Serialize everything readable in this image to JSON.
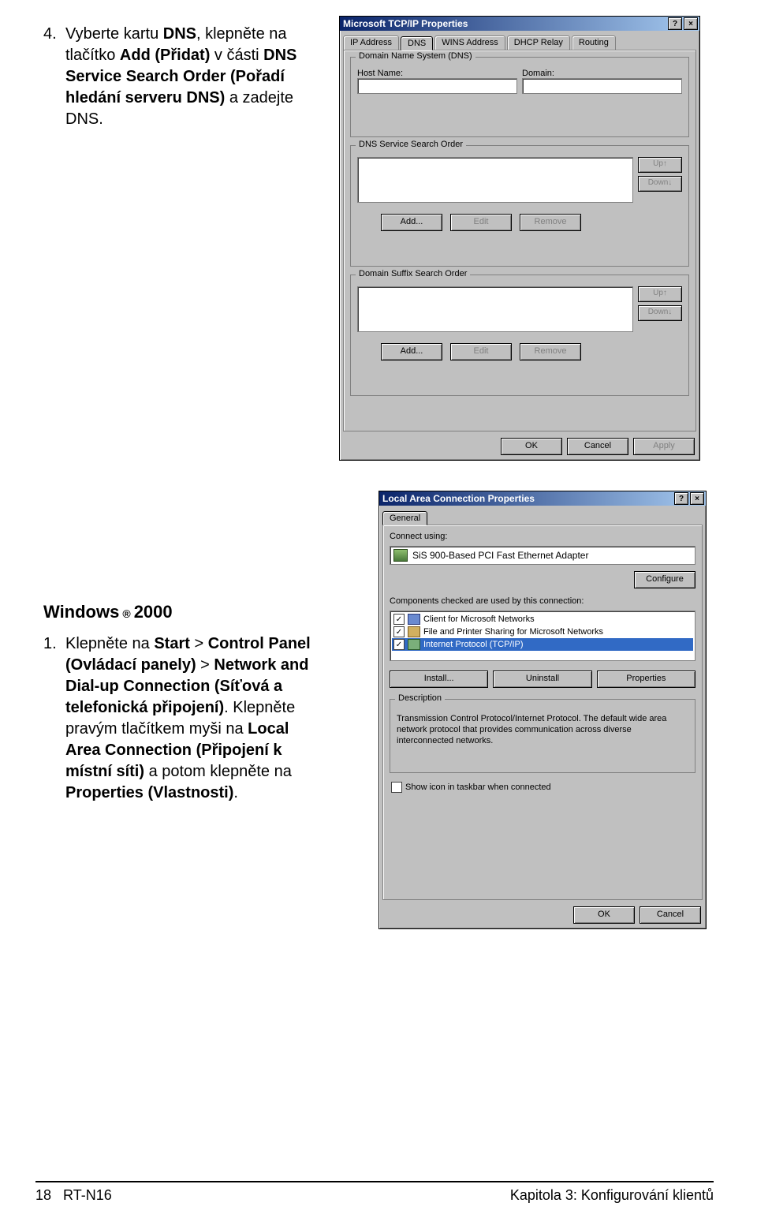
{
  "step4": {
    "num": "4.",
    "pre": "Vyberte kartu ",
    "dns": "DNS",
    "mid1": ", klepněte na tlačítko ",
    "add": "Add (Přidat)",
    "mid2": " v části ",
    "svc": "DNS Service Search Order (Pořadí hledání serveru DNS)",
    "post": " a zadejte DNS."
  },
  "heading2000": {
    "pre": "Windows",
    "reg": "®",
    "post": " 2000"
  },
  "step1": {
    "num": "1.",
    "t1": "Klepněte na ",
    "start": "Start",
    "t2": " > ",
    "cp": "Control Panel (Ovládací panely)",
    "t3": " > ",
    "nw": "Network and Dial-up Connection (Síťová a telefonická připojení)",
    "t4": ". Klepněte pravým tlačítkem myši na ",
    "lac": "Local Area Connection (Připojení k místní síti)",
    "t5": " a potom klepněte na ",
    "prop": "Properties (Vlastnosti)",
    "t6": "."
  },
  "dlg1": {
    "title": "Microsoft TCP/IP Properties",
    "help": "?",
    "close": "×",
    "tab_ip": "IP Address",
    "tab_dns": "DNS",
    "tab_wins": "WINS Address",
    "tab_dhcp": "DHCP Relay",
    "tab_rout": "Routing",
    "grp_dns": "Domain Name System (DNS)",
    "host": "Host Name:",
    "domain": "Domain:",
    "svc_label": "DNS Service Search Order",
    "suffix_label": "Domain Suffix Search Order",
    "up": "Up↑",
    "down": "Down↓",
    "add": "Add...",
    "edit": "Edit",
    "remove": "Remove",
    "ok": "OK",
    "cancel": "Cancel",
    "apply": "Apply"
  },
  "dlg2": {
    "title": "Local Area Connection Properties",
    "help": "?",
    "close": "×",
    "tab_gen": "General",
    "connect_using": "Connect using:",
    "adapter": "SiS 900-Based PCI Fast Ethernet Adapter",
    "configure": "Configure",
    "components_lbl": "Components checked are used by this connection:",
    "comp1": "Client for Microsoft Networks",
    "comp2": "File and Printer Sharing for Microsoft Networks",
    "comp3": "Internet Protocol (TCP/IP)",
    "install": "Install...",
    "uninstall": "Uninstall",
    "properties": "Properties",
    "desc_lbl": "Description",
    "desc_text": "Transmission Control Protocol/Internet Protocol. The default wide area network protocol that provides communication across diverse interconnected networks.",
    "showicon": "Show icon in taskbar when connected",
    "ok": "OK",
    "cancel": "Cancel"
  },
  "footer": {
    "page": "18",
    "model": "RT-N16",
    "chapter": "Kapitola 3: Konfigurování klientů"
  }
}
